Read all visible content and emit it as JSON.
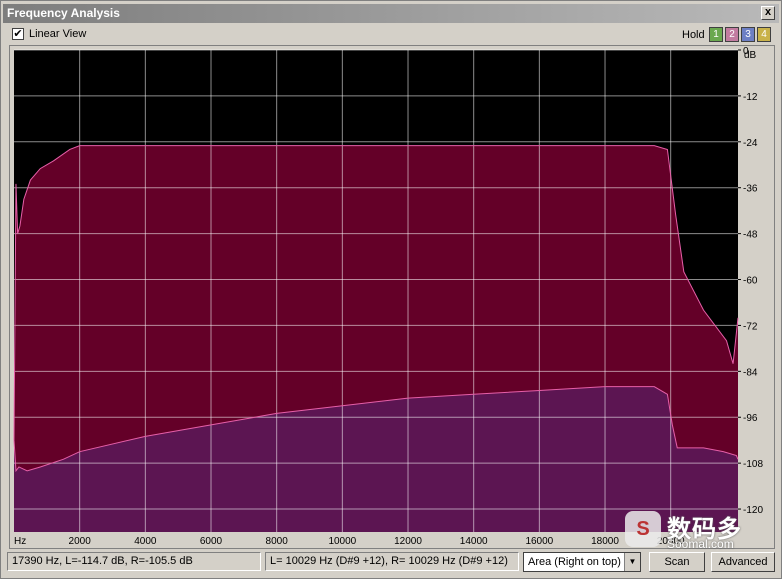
{
  "window": {
    "title": "Frequency Analysis",
    "close_label": "x"
  },
  "toolbar": {
    "linear_view_label": "Linear View",
    "linear_view_checked": true,
    "hold_label": "Hold",
    "hold_buttons": [
      {
        "label": "1",
        "color": "#6aa84f"
      },
      {
        "label": "2",
        "color": "#c27ba0"
      },
      {
        "label": "3",
        "color": "#6d7fc4"
      },
      {
        "label": "4",
        "color": "#c9b24a"
      }
    ]
  },
  "chart_data": {
    "type": "area",
    "ylabel": "dB",
    "xlabel": "Hz",
    "xlim": [
      0,
      22050
    ],
    "ylim": [
      -126,
      0
    ],
    "x_ticks": [
      "2000",
      "4000",
      "6000",
      "8000",
      "10000",
      "12000",
      "14000",
      "16000",
      "18000",
      "20000"
    ],
    "y_ticks": [
      "0",
      "-12",
      "-24",
      "-36",
      "-48",
      "-60",
      "-72",
      "-84",
      "-96",
      "-108",
      "-120"
    ],
    "grid": true,
    "colors": {
      "left": "#640028",
      "right": "#5c1552",
      "outline": "#e65fa8",
      "background": "#000000",
      "grid": "#ffffff"
    },
    "series": [
      {
        "channel": "left",
        "x": [
          0,
          60,
          110,
          180,
          300,
          500,
          800,
          1200,
          1700,
          2000,
          3000,
          8000,
          14000,
          18000,
          19500,
          19900,
          20150,
          20400,
          21000,
          21700,
          21900,
          22000,
          22050
        ],
        "y": [
          -102,
          -35,
          -48,
          -46,
          -39,
          -34,
          -31,
          -29,
          -26,
          -25,
          -25,
          -25,
          -25,
          -25,
          -25,
          -26,
          -43,
          -58,
          -68,
          -76,
          -82,
          -74,
          -70
        ]
      },
      {
        "channel": "right",
        "x": [
          0,
          60,
          150,
          400,
          800,
          1500,
          2000,
          4000,
          6000,
          8000,
          10000,
          12000,
          14000,
          16000,
          18000,
          19500,
          19900,
          20050,
          20200,
          21000,
          21600,
          22000,
          22050
        ],
        "y": [
          -102,
          -110,
          -109,
          -110,
          -109,
          -107,
          -105,
          -101,
          -98,
          -95,
          -93,
          -91,
          -90,
          -89,
          -88,
          -88,
          -90,
          -98,
          -104,
          -104,
          -105,
          -106,
          -107
        ]
      }
    ]
  },
  "status": {
    "cursor_readout": "17390 Hz, L=-114.7 dB, R=-105.5 dB",
    "peak_readout": "L=  10029 Hz (D#9 +12), R=  10029 Hz (D#9 +12)",
    "view_mode": "Area (Right on top)",
    "scan_label": "Scan",
    "advanced_label": "Advanced"
  },
  "watermark": {
    "brand_cn": "数码多",
    "url": "Soomal.com",
    "logo_glyph": "S"
  }
}
